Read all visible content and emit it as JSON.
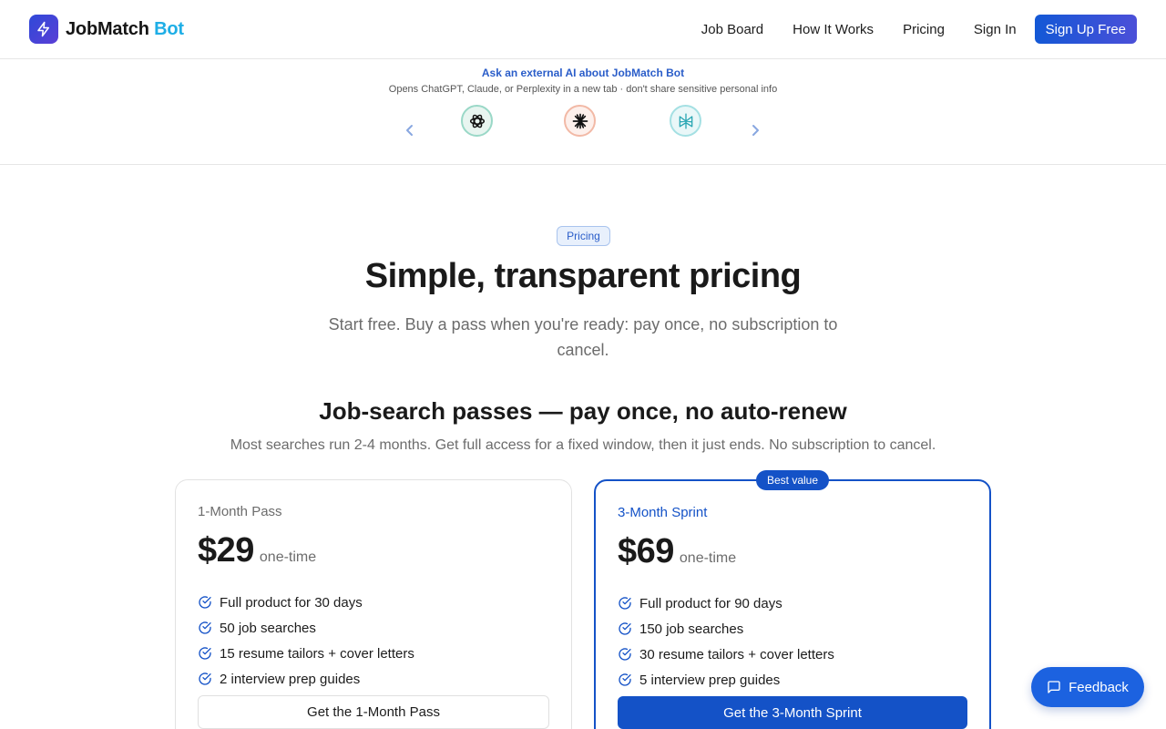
{
  "header": {
    "logo_text": "JobMatch",
    "logo_accent": "Bot",
    "nav": [
      "Job Board",
      "How It Works",
      "Pricing",
      "Sign In"
    ],
    "signup_label": "Sign Up Free"
  },
  "ai_strip": {
    "title": "Ask an external AI about JobMatch Bot",
    "subtitle": "Opens ChatGPT, Claude, or Perplexity in a new tab · don't share sensitive personal info",
    "icons": [
      "chatgpt-icon",
      "claude-icon",
      "perplexity-icon"
    ]
  },
  "hero": {
    "badge": "Pricing",
    "title": "Simple, transparent pricing",
    "subtitle": "Start free. Buy a pass when you're ready: pay once, no subscription to cancel."
  },
  "passes": {
    "title": "Job-search passes — pay once, no auto-renew",
    "subtitle": "Most searches run 2-4 months. Get full access for a fixed window, then it just ends. No subscription to cancel."
  },
  "plans": [
    {
      "name": "1-Month Pass",
      "price": "$29",
      "price_note": "one-time",
      "features": [
        "Full product for 30 days",
        "50 job searches",
        "15 resume tailors + cover letters",
        "2 interview prep guides"
      ],
      "cta": "Get the 1-Month Pass"
    },
    {
      "name": "3-Month Sprint",
      "badge": "Best value",
      "price": "$69",
      "price_note": "one-time",
      "features": [
        "Full product for 90 days",
        "150 job searches",
        "30 resume tailors + cover letters",
        "5 interview prep guides"
      ],
      "cta": "Get the 3-Month Sprint"
    }
  ],
  "feedback_label": "Feedback",
  "colors": {
    "primary": "#1452c7",
    "accent": "#1eaee6",
    "text": "#1a1a1a",
    "muted": "#6c6c6c"
  }
}
